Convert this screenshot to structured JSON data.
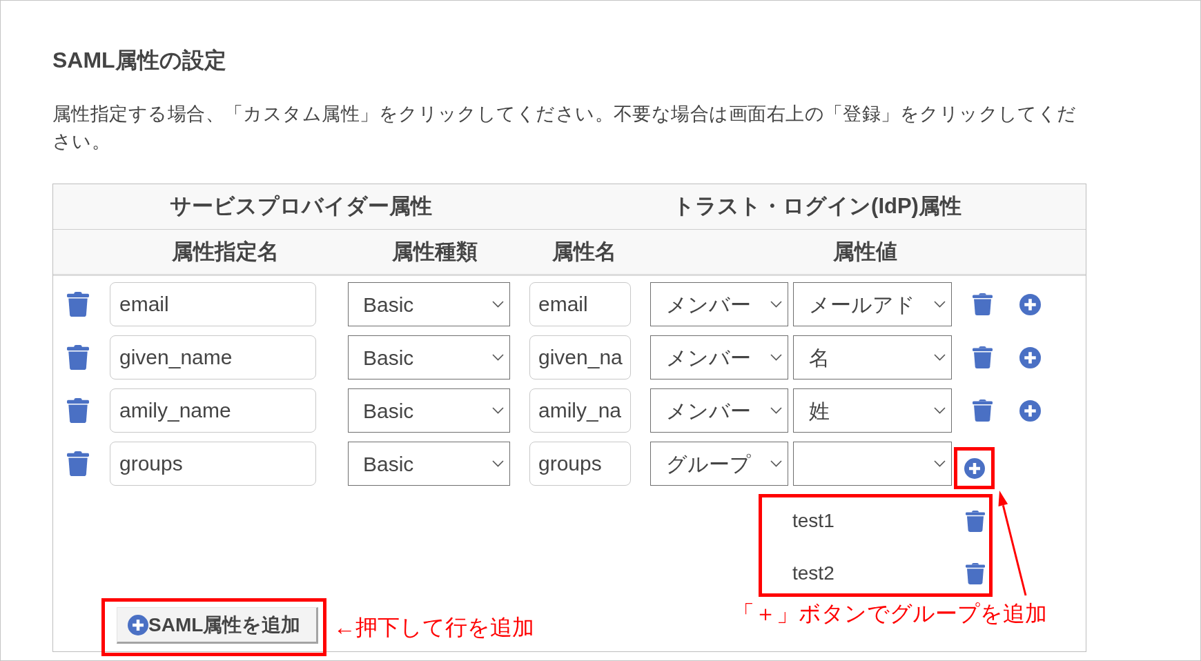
{
  "section": {
    "title": "SAML属性の設定",
    "description": "属性指定する場合、「カスタム属性」をクリックしてください。不要な場合は画面右上の「登録」をクリックしてください。"
  },
  "table": {
    "group_headers": [
      "サービスプロバイダー属性",
      "トラスト・ログイン(IdP)属性"
    ],
    "columns": [
      "属性指定名",
      "属性種類",
      "属性名",
      "属性値"
    ],
    "rows": [
      {
        "kind": "member",
        "name": "email",
        "type": "Basic",
        "attribute_name": "email",
        "source": "メンバー",
        "value": "メールアド",
        "highlighted": false
      },
      {
        "kind": "member",
        "name": "given_name",
        "type": "Basic",
        "attribute_name": "given_na",
        "source": "メンバー",
        "value": "名",
        "highlighted": false
      },
      {
        "kind": "member",
        "name": "amily_name",
        "type": "Basic",
        "attribute_name": "amily_na",
        "source": "メンバー",
        "value": "姓",
        "highlighted": false
      },
      {
        "kind": "group",
        "name": "groups",
        "type": "Basic",
        "attribute_name": "groups",
        "source": "グループ",
        "highlighted": true,
        "groups": {
          "highlighted": true,
          "items": [
            "test1",
            "test2"
          ]
        }
      }
    ]
  },
  "add_button": {
    "label": "SAML属性を追加",
    "highlighted": true
  },
  "annotations": [
    {
      "text": "←押下して行を追加"
    },
    {
      "text": "「＋」ボタンでグループを追加"
    }
  ]
}
